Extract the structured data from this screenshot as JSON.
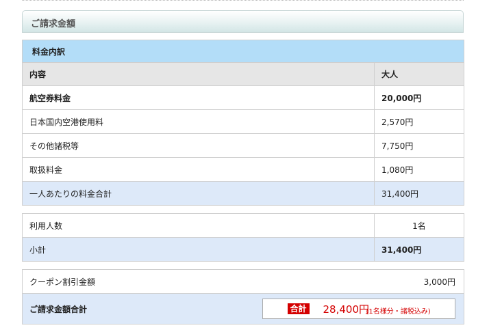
{
  "section_title": "ご請求金額",
  "breakdown": {
    "title": "料金内訳",
    "header": {
      "item": "内容",
      "adult": "大人"
    },
    "rows": [
      {
        "item": "航空券料金",
        "amount": "20,000円"
      },
      {
        "item": "日本国内空港使用料",
        "amount": "2,570円"
      },
      {
        "item": "その他諸税等",
        "amount": "7,750円"
      },
      {
        "item": "取扱料金",
        "amount": "1,080円"
      }
    ],
    "per_person_total": {
      "label": "一人あたりの料金合計",
      "amount": "31,400円"
    }
  },
  "people": {
    "count_label": "利用人数",
    "count_value": "1名",
    "subtotal_label": "小計",
    "subtotal_value": "31,400円"
  },
  "summary": {
    "coupon_label": "クーポン割引金額",
    "coupon_value": "3,000円",
    "total_label": "ご請求金額合計",
    "total_badge": "合計",
    "total_amount": "28,400円",
    "total_note": "(1名様分・諸税込み)"
  },
  "colors": {
    "accent": "#d40000",
    "title_bg": "#b3ddf8",
    "row_highlight": "#dde9f9"
  }
}
